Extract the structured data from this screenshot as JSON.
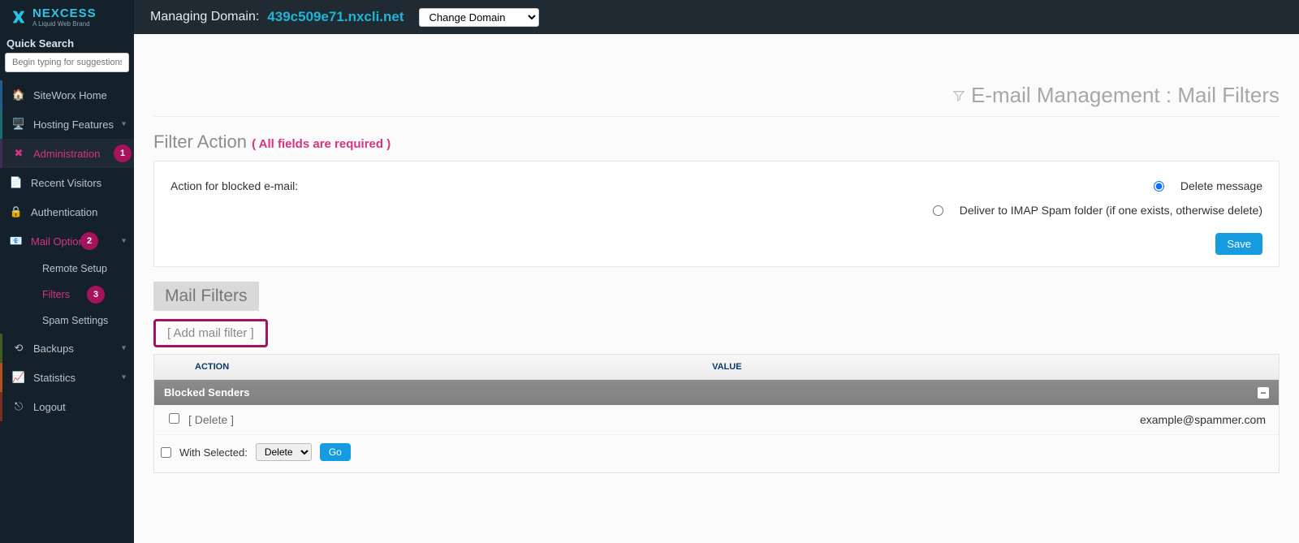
{
  "brand": {
    "name": "NEXCESS",
    "tagline": "A Liquid Web Brand"
  },
  "quickSearch": {
    "label": "Quick Search",
    "placeholder": "Begin typing for suggestions"
  },
  "sidebar": {
    "siteworx": "SiteWorx Home",
    "hosting": "Hosting Features",
    "administration": "Administration",
    "recentVisitors": "Recent Visitors",
    "authentication": "Authentication",
    "mailOptions": "Mail Options",
    "mailSub": {
      "remote": "Remote Setup",
      "filters": "Filters",
      "spam": "Spam Settings"
    },
    "backups": "Backups",
    "statistics": "Statistics",
    "logout": "Logout"
  },
  "badges": {
    "administration": "1",
    "mailOptions": "2",
    "filters": "3"
  },
  "topbar": {
    "managing": "Managing Domain:",
    "domain": "439c509e71.nxcli.net",
    "changeDomain": "Change Domain"
  },
  "pageTitle": "E-mail Management : Mail Filters",
  "filterAction": {
    "heading": "Filter Action",
    "required": "( All fields are required )",
    "label": "Action for blocked e-mail:",
    "opt1": "Delete message",
    "opt2": "Deliver to IMAP Spam folder (if one exists, otherwise delete)",
    "save": "Save"
  },
  "mailFilters": {
    "heading": "Mail Filters",
    "addLink": "[ Add mail filter ]",
    "columns": {
      "action": "ACTION",
      "value": "VALUE"
    },
    "group": "Blocked Senders",
    "rows": [
      {
        "action": "[ Delete ]",
        "value": "example@spammer.com"
      }
    ],
    "withSelected": "With Selected:",
    "bulkAction": "Delete",
    "go": "Go"
  }
}
